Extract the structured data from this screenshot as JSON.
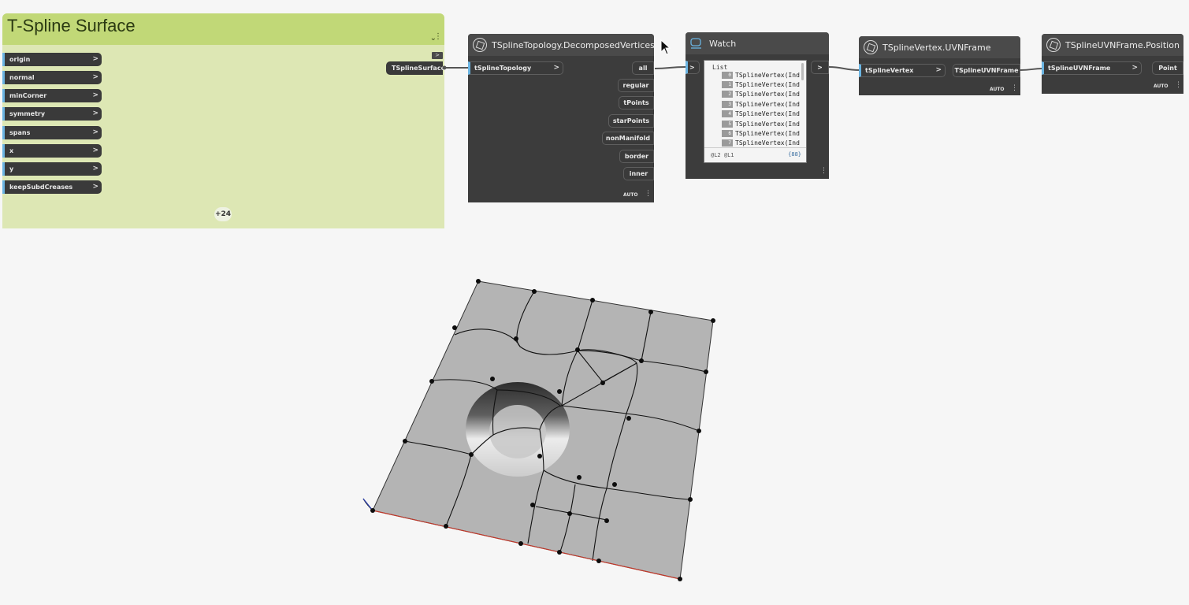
{
  "group": {
    "title": "T-Spline Surface",
    "badge": "+24",
    "color": "#c1d877",
    "body_color": "#dde7b4",
    "inputs": [
      "origin",
      "normal",
      "minCorner",
      "symmetry",
      "spans",
      "x",
      "y",
      "keepSubdCreases"
    ],
    "output": "TSplineSurface",
    "collapse_glyph": ">"
  },
  "nodes": {
    "decomposed": {
      "title": "TSplineTopology.DecomposedVertices",
      "input": "tSplineTopology",
      "outputs": [
        "all",
        "regular",
        "tPoints",
        "starPoints",
        "nonManifold",
        "border",
        "inner"
      ],
      "lacing": "AUTO"
    },
    "watch": {
      "title": "Watch",
      "input_glyph": ">",
      "output_glyph": ">",
      "list_label": "List",
      "items": [
        {
          "index": "0",
          "text": "TSplineVertex(Ind"
        },
        {
          "index": "1",
          "text": "TSplineVertex(Ind"
        },
        {
          "index": "2",
          "text": "TSplineVertex(Ind"
        },
        {
          "index": "3",
          "text": "TSplineVertex(Ind"
        },
        {
          "index": "4",
          "text": "TSplineVertex(Ind"
        },
        {
          "index": "5",
          "text": "TSplineVertex(Ind"
        },
        {
          "index": "6",
          "text": "TSplineVertex(Ind"
        },
        {
          "index": "7",
          "text": "TSplineVertex(Ind"
        }
      ],
      "levels": "@L2 @L1",
      "count": "{88}"
    },
    "uvnframe": {
      "title": "TSplineVertex.UVNFrame",
      "input": "tSplineVertex",
      "output": "TSplineUVNFrame",
      "lacing": "AUTO"
    },
    "position": {
      "title": "TSplineUVNFrame.Position",
      "input": "tSplineUVNFrame",
      "output": "Point",
      "lacing": "AUTO"
    }
  },
  "colors": {
    "node_dark": "#3c3c3c",
    "port_accent": "#6ab4e2",
    "surface": "#b4b4b4",
    "x_axis": "#c0392b",
    "y_axis": "#2a3fb0"
  }
}
